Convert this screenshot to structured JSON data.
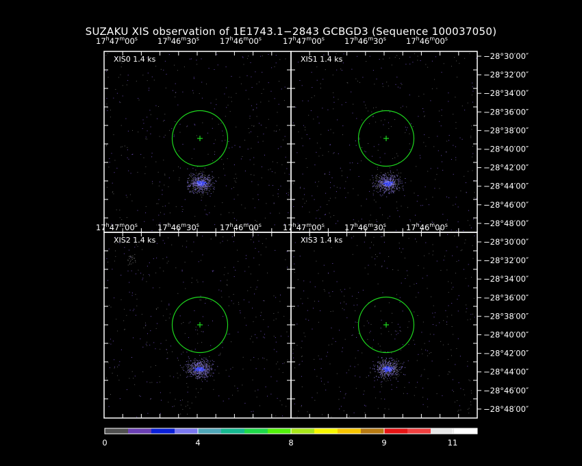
{
  "title": "SUZAKU XIS observation of 1E1743.1−2843 GCBGD3  (Sequence 100037050)",
  "chart_data": {
    "type": "heatmap",
    "panels": [
      {
        "label": "XIS0  1.4 ks"
      },
      {
        "label": "XIS1  1.4 ks"
      },
      {
        "label": "XIS2  1.4 ks"
      },
      {
        "label": "XIS3  1.4 ks"
      }
    ],
    "ra_ticks": [
      {
        "h": "17",
        "m": "47",
        "s": "00"
      },
      {
        "h": "17",
        "m": "46",
        "s": "30"
      },
      {
        "h": "17",
        "m": "46",
        "s": "00"
      }
    ],
    "dec_ticks": [
      "−28°30′00″",
      "−28°32′00″",
      "−28°34′00″",
      "−28°36′00″",
      "−28°38′00″",
      "−28°40′00″",
      "−28°42′00″",
      "−28°44′00″",
      "−28°46′00″",
      "−28°48′00″"
    ],
    "colorbar": {
      "labels": [
        "0",
        "4",
        "8",
        "9",
        "11"
      ],
      "colors": [
        "#505050",
        "#6a3fb3",
        "#0a1fd8",
        "#7a78f0",
        "#4fa6b8",
        "#16b890",
        "#1ed84a",
        "#52f00a",
        "#a8e61a",
        "#f6f600",
        "#f6c400",
        "#b77a12",
        "#e61414",
        "#f04040",
        "#e6e6e6",
        "#ffffff"
      ]
    }
  }
}
